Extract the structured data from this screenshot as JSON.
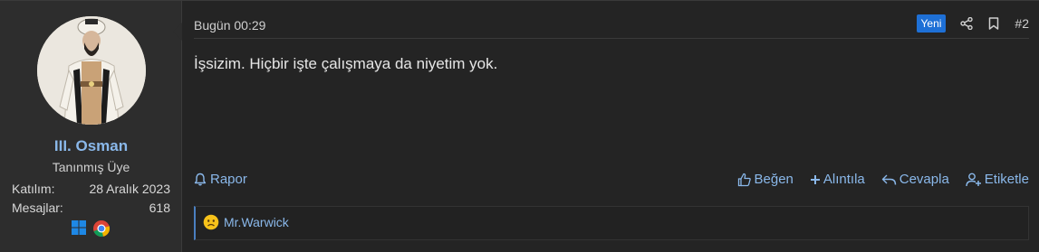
{
  "user": {
    "name": "III. Osman",
    "title": "Tanınmış Üye",
    "stats": [
      {
        "label": "Katılım:",
        "value": "28 Aralık 2023"
      },
      {
        "label": "Mesajlar:",
        "value": "618"
      }
    ],
    "avatar_icon": "portrait-avatar",
    "os_icons": [
      "windows-icon",
      "chrome-icon"
    ]
  },
  "post": {
    "date": "Bugün 00:29",
    "badge": "Yeni",
    "number": "#2",
    "text": "İşsizim. Hiçbir işte çalışmaya da niyetim yok."
  },
  "actions": {
    "report": "Rapor",
    "like": "Beğen",
    "quote": "Alıntıla",
    "reply": "Cevapla",
    "tag": "Etiketle"
  },
  "reactions": {
    "user": "Mr.Warwick",
    "icon": "sad-face-emoji"
  },
  "colors": {
    "link": "#8ab8ea",
    "badge": "#1e70d6",
    "background": "#242424",
    "user_cell": "#2d2d2d"
  }
}
